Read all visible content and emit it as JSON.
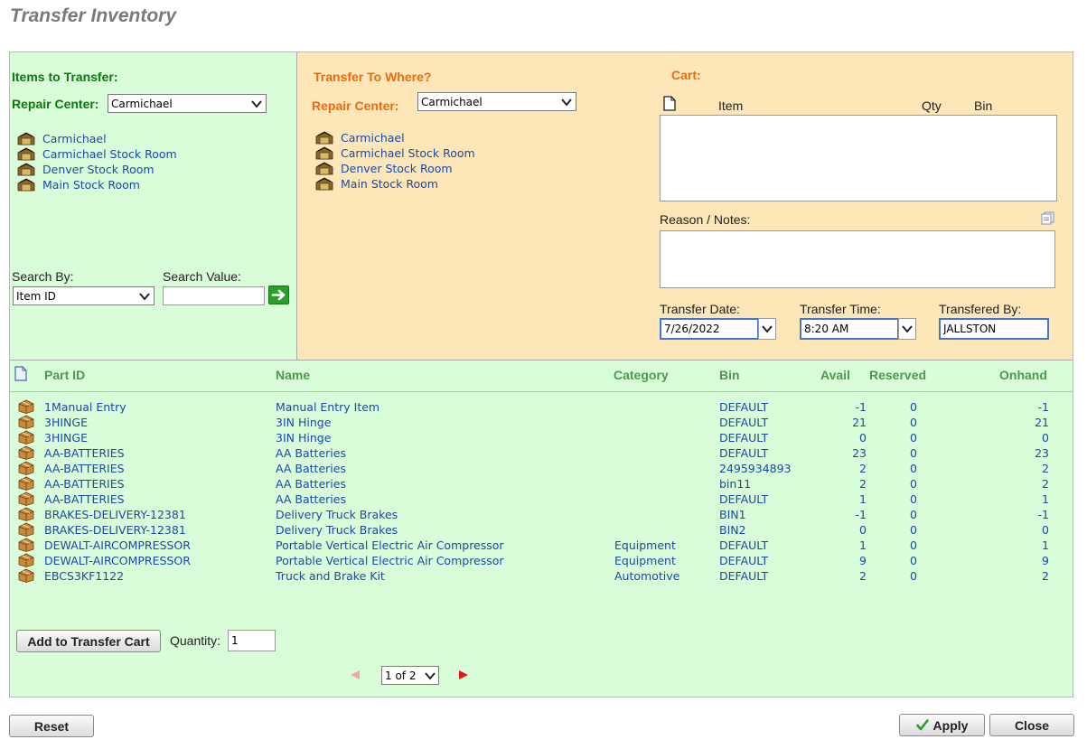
{
  "page": {
    "title": "Transfer Inventory"
  },
  "items_to_transfer": {
    "title": "Items to Transfer:",
    "repair_center_label": "Repair Center:",
    "repair_center_value": "Carmichael",
    "locations": [
      "Carmichael",
      "Carmichael Stock Room",
      "Denver Stock Room",
      "Main Stock Room"
    ],
    "search_by_label": "Search By:",
    "search_by_value": "Item ID",
    "search_value_label": "Search Value:",
    "search_value": ""
  },
  "transfer_to": {
    "title": "Transfer To Where?",
    "repair_center_label": "Repair Center:",
    "repair_center_value": "Carmichael",
    "locations": [
      "Carmichael",
      "Carmichael Stock Room",
      "Denver Stock Room",
      "Main Stock Room"
    ]
  },
  "cart": {
    "title": "Cart:",
    "col_item": "Item",
    "col_qty": "Qty",
    "col_bin": "Bin",
    "reason_label": "Reason / Notes:",
    "reason_value": "",
    "transfer_date_label": "Transfer Date:",
    "transfer_date": "7/26/2022",
    "transfer_time_label": "Transfer Time:",
    "transfer_time": "8:20 AM",
    "transferred_by_label": "Transfered By:",
    "transferred_by": "JALLSTON"
  },
  "grid": {
    "columns": {
      "part_id": "Part ID",
      "name": "Name",
      "category": "Category",
      "bin": "Bin",
      "avail": "Avail",
      "reserved": "Reserved",
      "onhand": "Onhand"
    },
    "rows": [
      {
        "part_id": "1Manual Entry",
        "name": "Manual Entry Item",
        "category": "",
        "bin": "DEFAULT",
        "avail": "-1",
        "reserved": "0",
        "onhand": "-1"
      },
      {
        "part_id": "3HINGE",
        "name": "3IN Hinge",
        "category": "",
        "bin": "DEFAULT",
        "avail": "21",
        "reserved": "0",
        "onhand": "21"
      },
      {
        "part_id": "3HINGE",
        "name": "3IN Hinge",
        "category": "",
        "bin": "DEFAULT",
        "avail": "0",
        "reserved": "0",
        "onhand": "0"
      },
      {
        "part_id": "AA-BATTERIES",
        "name": "AA Batteries",
        "category": "",
        "bin": "DEFAULT",
        "avail": "23",
        "reserved": "0",
        "onhand": "23"
      },
      {
        "part_id": "AA-BATTERIES",
        "name": "AA Batteries",
        "category": "",
        "bin": "2495934893",
        "avail": "2",
        "reserved": "0",
        "onhand": "2"
      },
      {
        "part_id": "AA-BATTERIES",
        "name": "AA Batteries",
        "category": "",
        "bin": "bin11",
        "avail": "2",
        "reserved": "0",
        "onhand": "2"
      },
      {
        "part_id": "AA-BATTERIES",
        "name": "AA Batteries",
        "category": "",
        "bin": "DEFAULT",
        "avail": "1",
        "reserved": "0",
        "onhand": "1"
      },
      {
        "part_id": "BRAKES-DELIVERY-12381",
        "name": "Delivery Truck Brakes",
        "category": "",
        "bin": "BIN1",
        "avail": "-1",
        "reserved": "0",
        "onhand": "-1"
      },
      {
        "part_id": "BRAKES-DELIVERY-12381",
        "name": "Delivery Truck Brakes",
        "category": "",
        "bin": "BIN2",
        "avail": "0",
        "reserved": "0",
        "onhand": "0"
      },
      {
        "part_id": "DEWALT-AIRCOMPRESSOR",
        "name": "Portable Vertical Electric Air Compressor",
        "category": "Equipment",
        "bin": "DEFAULT",
        "avail": "1",
        "reserved": "0",
        "onhand": "1"
      },
      {
        "part_id": "DEWALT-AIRCOMPRESSOR",
        "name": "Portable Vertical Electric Air Compressor",
        "category": "Equipment",
        "bin": "DEFAULT",
        "avail": "9",
        "reserved": "0",
        "onhand": "9"
      },
      {
        "part_id": "EBCS3KF1122",
        "name": "Truck and Brake Kit",
        "category": "Automotive",
        "bin": "DEFAULT",
        "avail": "2",
        "reserved": "0",
        "onhand": "2"
      }
    ]
  },
  "footer": {
    "add_to_cart_label": "Add to Transfer Cart",
    "quantity_label": "Quantity:",
    "quantity_value": "1",
    "pager_value": "1 of 2",
    "reset_label": "Reset",
    "apply_label": "Apply",
    "close_label": "Close"
  },
  "icons": {
    "location": "warehouse-icon",
    "part": "box-icon",
    "new_doc": "new-document-icon",
    "notes": "notes-icon",
    "go": "go-arrow-icon",
    "apply": "checkmark-icon"
  },
  "colors": {
    "left_panel": "#d9fcd9",
    "right_panel": "#fde6b8",
    "title_green": "#0a7a0a",
    "title_orange": "#ee6a0c",
    "link_blue": "#1a4aa8",
    "grid_header": "#4c9a4c"
  }
}
